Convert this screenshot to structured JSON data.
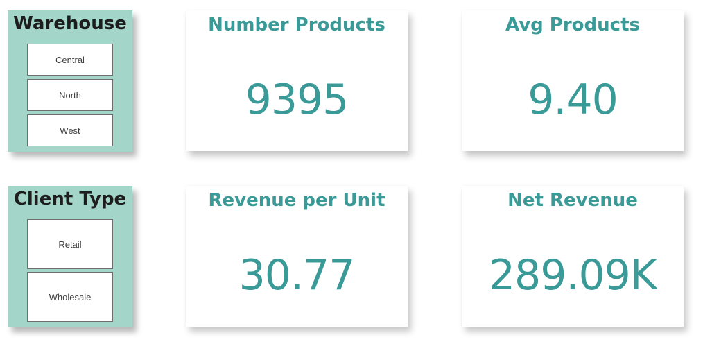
{
  "slicers": {
    "warehouse": {
      "title": "Warehouse",
      "options": [
        "Central",
        "North",
        "West"
      ]
    },
    "client_type": {
      "title": "Client Type",
      "options": [
        "Retail",
        "Wholesale"
      ]
    }
  },
  "cards": {
    "number_products": {
      "title": "Number Products",
      "value": "9395"
    },
    "avg_products": {
      "title": "Avg Products",
      "value": "9.40"
    },
    "revenue_per_unit": {
      "title": "Revenue per Unit",
      "value": "30.77"
    },
    "net_revenue": {
      "title": "Net Revenue",
      "value": "289.09K"
    }
  },
  "colors": {
    "slicer_background": "#a3d5c8",
    "accent": "#3a9a97",
    "slicer_title": "#1d1d1d"
  }
}
